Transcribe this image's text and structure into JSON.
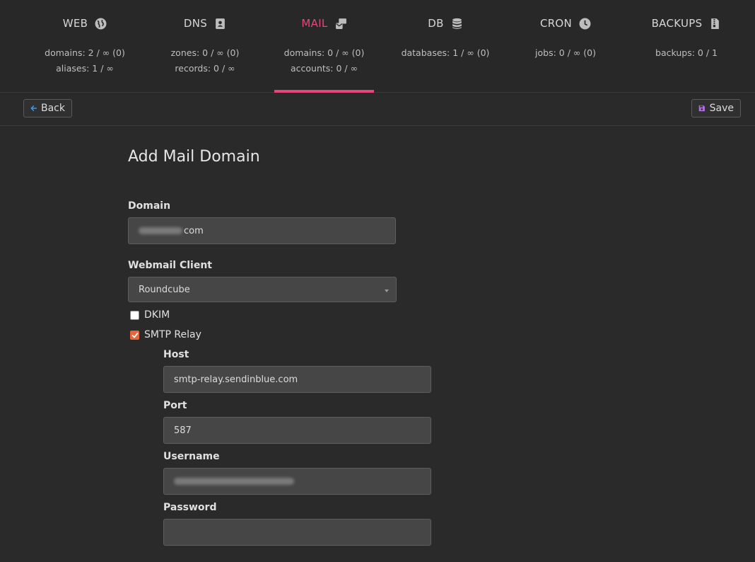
{
  "stats": [
    {
      "name": "WEB",
      "icon": "globe-icon",
      "lines": [
        "domains: 2 / ∞ (0)",
        "aliases: 1 / ∞"
      ],
      "active": false
    },
    {
      "name": "DNS",
      "icon": "address-book-icon",
      "lines": [
        "zones: 0 / ∞ (0)",
        "records: 0 / ∞"
      ],
      "active": false
    },
    {
      "name": "MAIL",
      "icon": "mail-bulk-icon",
      "lines": [
        "domains: 0 / ∞ (0)",
        "accounts: 0 / ∞"
      ],
      "active": true
    },
    {
      "name": "DB",
      "icon": "database-icon",
      "lines": [
        "databases: 1 / ∞ (0)"
      ],
      "active": false
    },
    {
      "name": "CRON",
      "icon": "clock-icon",
      "lines": [
        "jobs: 0 / ∞ (0)"
      ],
      "active": false
    },
    {
      "name": "BACKUPS",
      "icon": "file-archive-icon",
      "lines": [
        "backups: 0 / 1"
      ],
      "active": false
    }
  ],
  "toolbar": {
    "back_label": "Back",
    "save_label": "Save"
  },
  "form": {
    "title": "Add Mail Domain",
    "domain_label": "Domain",
    "domain_value_suffix": "com",
    "webmail_label": "Webmail Client",
    "webmail_value": "Roundcube",
    "dkim_label": "DKIM",
    "dkim_checked": false,
    "smtp_relay_label": "SMTP Relay",
    "smtp_relay_checked": true,
    "host_label": "Host",
    "host_value": "smtp-relay.sendinblue.com",
    "port_label": "Port",
    "port_value": "587",
    "username_label": "Username",
    "password_label": "Password",
    "password_value": ""
  },
  "colors": {
    "accent": "#e8457a",
    "checkbox": "#e8653a",
    "back_icon": "#3d9be9",
    "save_icon": "#b26ee6"
  }
}
